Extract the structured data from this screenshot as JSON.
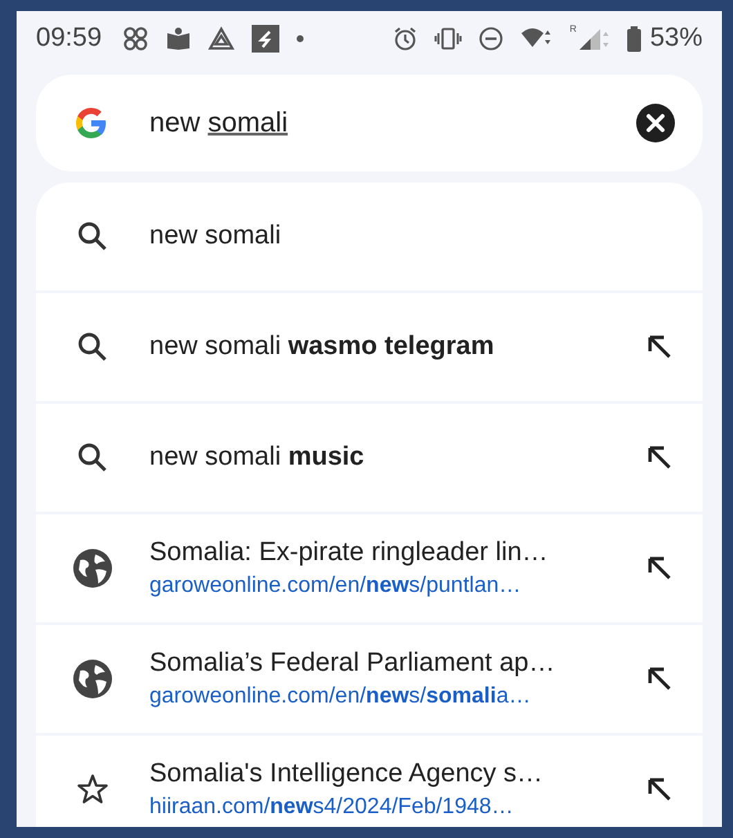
{
  "status_bar": {
    "time": "09:59",
    "roaming": "R",
    "battery": "53%"
  },
  "search": {
    "value": "new ",
    "composing": "somali"
  },
  "suggestions": [
    {
      "kind": "query",
      "text": "new somali",
      "arrow": false
    },
    {
      "kind": "query",
      "text": "new somali **wasmo telegram**",
      "arrow": true
    },
    {
      "kind": "query",
      "text": "new somali **music**",
      "arrow": true
    },
    {
      "kind": "site",
      "text": "Somalia: Ex-pirate ringleader lin…",
      "url": "garoweonline.com/en/**new**s/puntlan…",
      "arrow": true
    },
    {
      "kind": "site",
      "text": "Somalia’s Federal Parliament ap…",
      "url": "garoweonline.com/en/**new**s/**somali**a…",
      "arrow": true
    },
    {
      "kind": "bookmark",
      "text": "Somalia's Intelligence Agency s…",
      "url": "hiiraan.com/**new**s4/2024/Feb/1948…",
      "arrow": true
    }
  ]
}
